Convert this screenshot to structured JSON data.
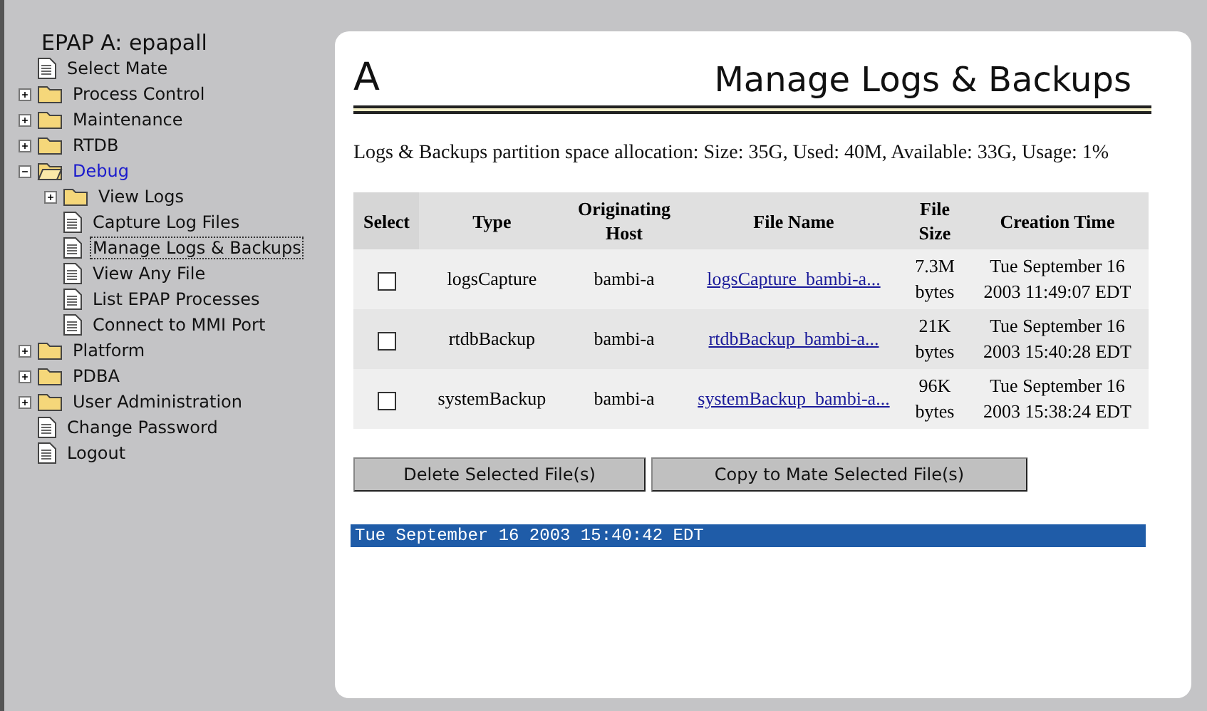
{
  "sidebar": {
    "title": "EPAP A: epapall",
    "items": [
      {
        "kind": "page",
        "label": "Select Mate",
        "selected": false
      },
      {
        "kind": "folder",
        "label": "Process Control",
        "expanded": false,
        "selected": false
      },
      {
        "kind": "folder",
        "label": "Maintenance",
        "expanded": false,
        "selected": false
      },
      {
        "kind": "folder",
        "label": "RTDB",
        "expanded": false,
        "selected": false
      },
      {
        "kind": "folder",
        "label": "Debug",
        "expanded": true,
        "selected": false,
        "children": [
          {
            "kind": "folder",
            "label": "View Logs",
            "expanded": false,
            "selected": false
          },
          {
            "kind": "page",
            "label": "Capture Log Files",
            "selected": false
          },
          {
            "kind": "page",
            "label": "Manage Logs & Backups",
            "selected": true
          },
          {
            "kind": "page",
            "label": "View Any File",
            "selected": false
          },
          {
            "kind": "page",
            "label": "List EPAP Processes",
            "selected": false
          },
          {
            "kind": "page",
            "label": "Connect to MMI Port",
            "selected": false
          }
        ]
      },
      {
        "kind": "folder",
        "label": "Platform",
        "expanded": false,
        "selected": false
      },
      {
        "kind": "folder",
        "label": "PDBA",
        "expanded": false,
        "selected": false
      },
      {
        "kind": "folder",
        "label": "User Administration",
        "expanded": false,
        "selected": false
      },
      {
        "kind": "page",
        "label": "Change Password",
        "selected": false
      },
      {
        "kind": "page",
        "label": "Logout",
        "selected": false
      }
    ]
  },
  "header": {
    "badge": "A",
    "title": "Manage Logs & Backups"
  },
  "allocation": "Logs & Backups partition space allocation: Size: 35G, Used: 40M, Available: 33G, Usage: 1%",
  "table": {
    "columns": [
      "Select",
      "Type",
      "Originating Host",
      "File Name",
      "File Size",
      "Creation Time"
    ],
    "rows": [
      {
        "checked": false,
        "type": "logsCapture",
        "host": "bambi-a",
        "file": "logsCapture_bambi-a...",
        "size": "7.3M bytes",
        "time": "Tue September 16 2003 11:49:07 EDT"
      },
      {
        "checked": false,
        "type": "rtdbBackup",
        "host": "bambi-a",
        "file": "rtdbBackup_bambi-a...",
        "size": "21K bytes",
        "time": "Tue September 16 2003 15:40:28 EDT"
      },
      {
        "checked": false,
        "type": "systemBackup",
        "host": "bambi-a",
        "file": "systemBackup_bambi-a...",
        "size": "96K bytes",
        "time": "Tue September 16 2003 15:38:24 EDT"
      }
    ]
  },
  "buttons": [
    "Delete Selected File(s)",
    "Copy to Mate Selected File(s)"
  ],
  "status_bar": "Tue September 16 2003 15:40:42 EDT"
}
